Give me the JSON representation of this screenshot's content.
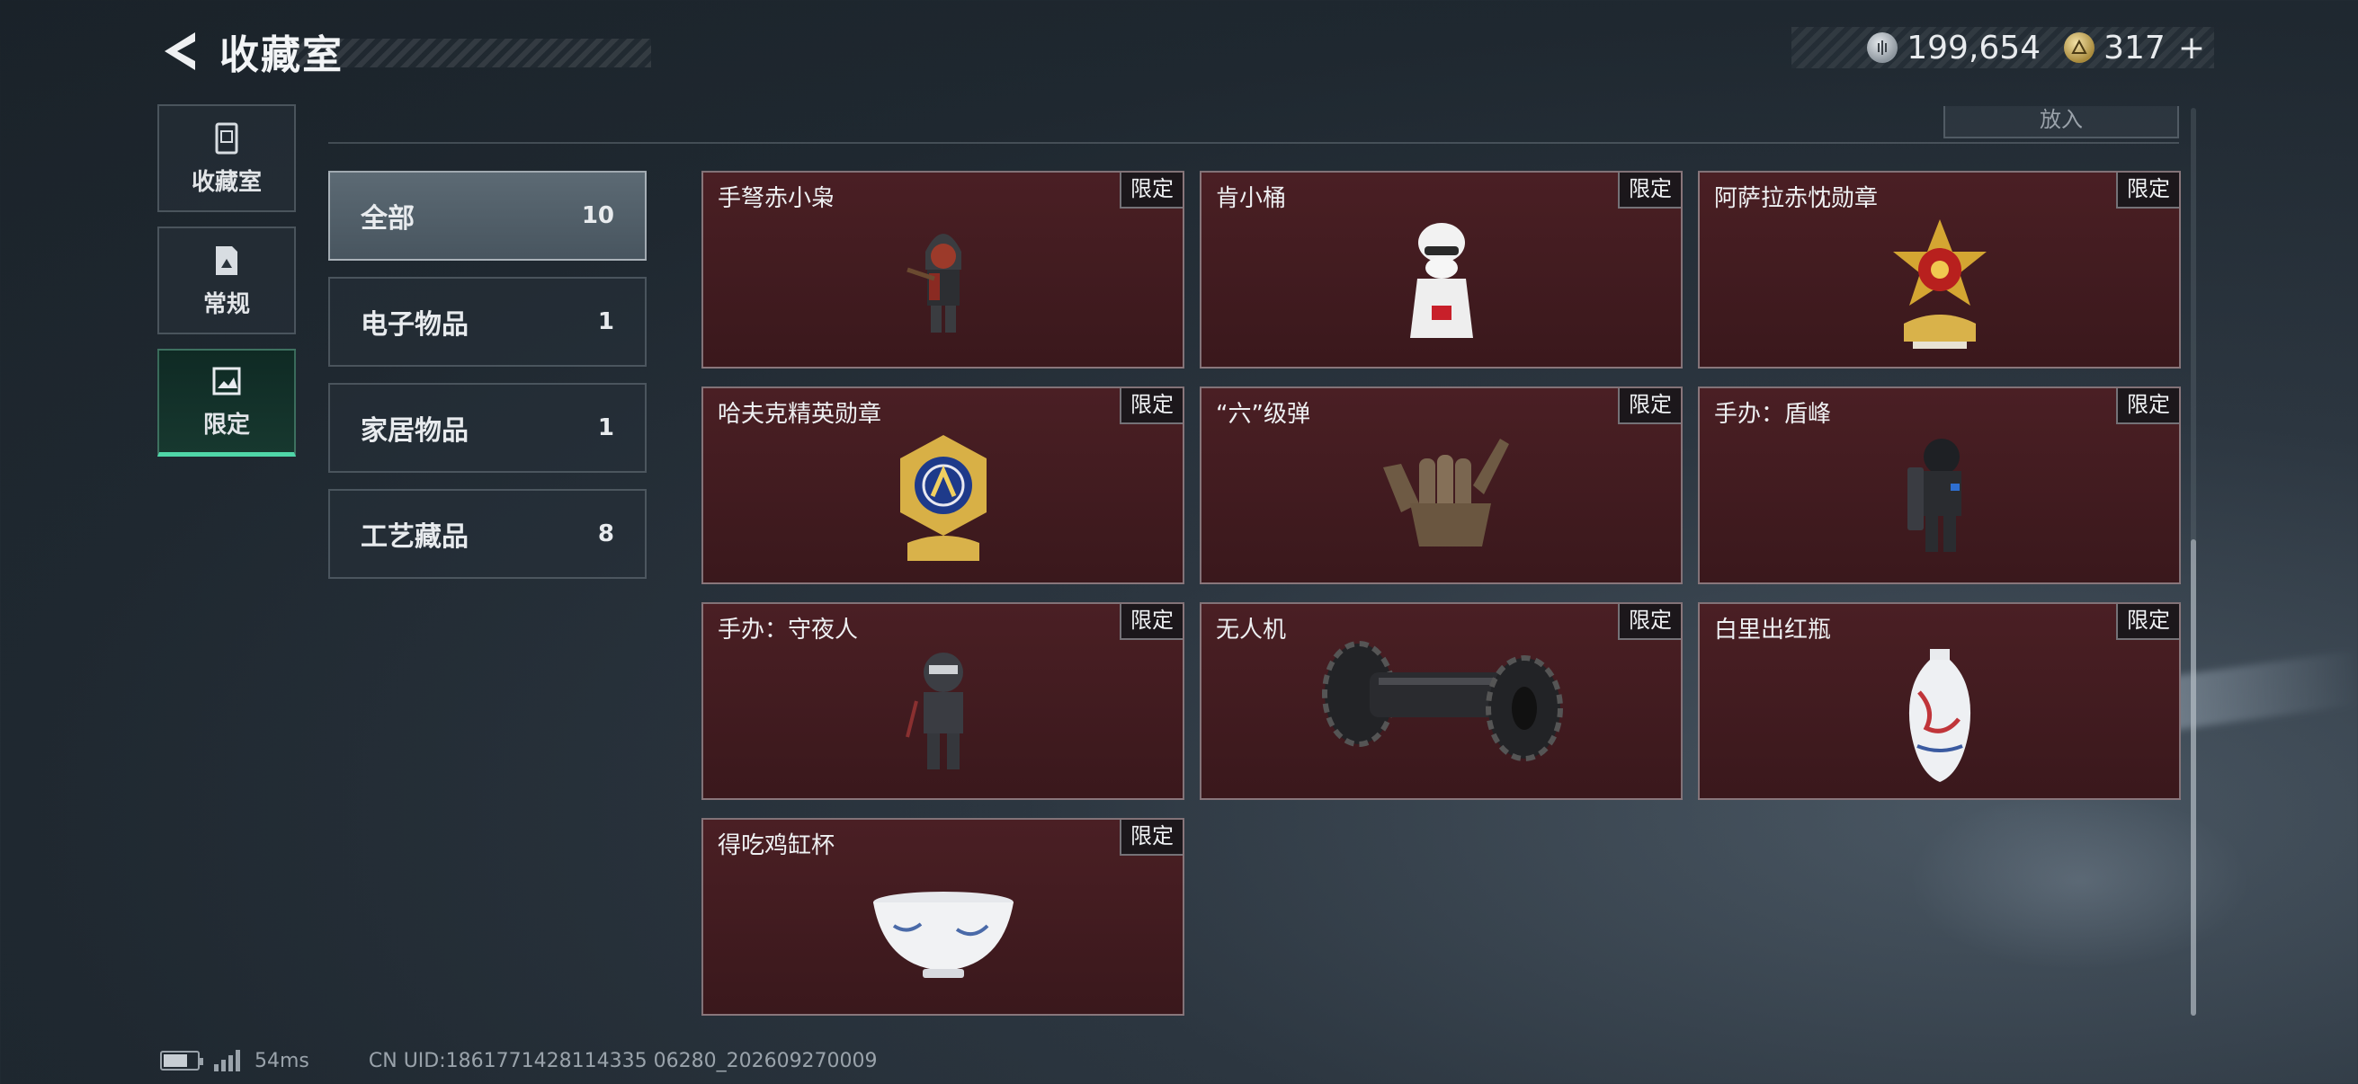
{
  "header": {
    "title": "收藏室",
    "currencies": [
      {
        "icon": "silver-coin-icon",
        "value": "199,654"
      },
      {
        "icon": "gold-coin-icon",
        "value": "317"
      }
    ],
    "add_label": "+"
  },
  "side_nav": {
    "items": [
      {
        "label": "收藏室",
        "icon": "trash-bin-icon",
        "active": false
      },
      {
        "label": "常规",
        "icon": "document-icon",
        "active": false
      },
      {
        "label": "限定",
        "icon": "image-icon",
        "active": true
      }
    ]
  },
  "top_button_stub": "放入",
  "filters": [
    {
      "label": "全部",
      "count": "10",
      "active": true
    },
    {
      "label": "电子物品",
      "count": "1",
      "active": false
    },
    {
      "label": "家居物品",
      "count": "1",
      "active": false
    },
    {
      "label": "工艺藏品",
      "count": "8",
      "active": false
    }
  ],
  "items": [
    {
      "name": "手弩赤小枭",
      "tag": "限定",
      "art": "hooded-figure-icon"
    },
    {
      "name": "肯小桶",
      "tag": "限定",
      "art": "chef-bust-icon"
    },
    {
      "name": "阿萨拉赤忱勋章",
      "tag": "限定",
      "art": "gold-star-medal-icon"
    },
    {
      "name": "哈夫克精英勋章",
      "tag": "限定",
      "art": "gold-hex-medal-icon"
    },
    {
      "name": "“六”级弹",
      "tag": "限定",
      "art": "hand-sculpture-icon"
    },
    {
      "name": "手办：盾峰",
      "tag": "限定",
      "art": "shield-soldier-icon"
    },
    {
      "name": "手办：守夜人",
      "tag": "限定",
      "art": "masked-soldier-icon"
    },
    {
      "name": "无人机",
      "tag": "限定",
      "art": "drone-roller-icon"
    },
    {
      "name": "白里出红瓶",
      "tag": "限定",
      "art": "porcelain-vase-icon"
    },
    {
      "name": "得吃鸡缸杯",
      "tag": "限定",
      "art": "porcelain-cup-icon"
    }
  ],
  "footer": {
    "ping": "54ms",
    "uid": "CN UID:1861771428114335 06280_202609270009"
  },
  "colors": {
    "card_bg": "#4a1f24",
    "active_accent": "#4fd6a8"
  }
}
